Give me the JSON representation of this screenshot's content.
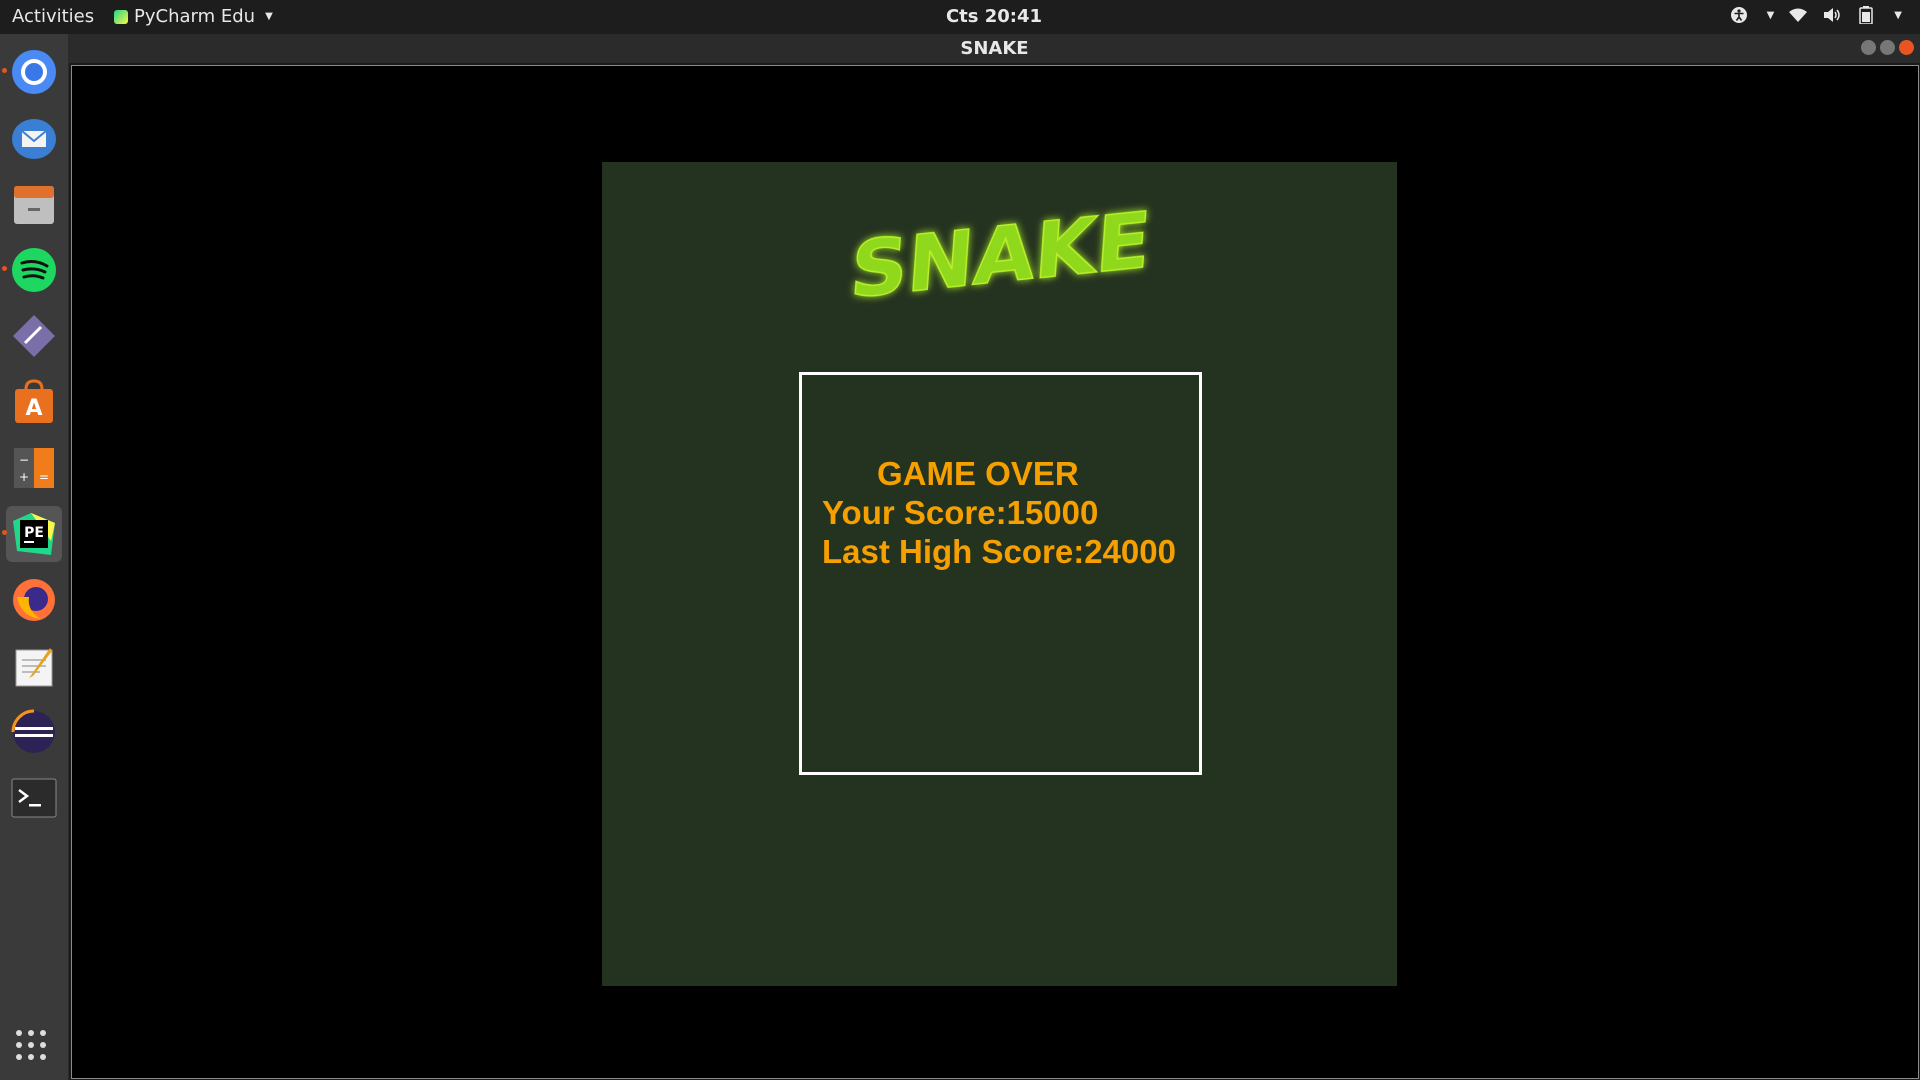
{
  "topbar": {
    "activities": "Activities",
    "app_name": "PyCharm Edu",
    "clock": "Cts 20:41"
  },
  "dock": {
    "items": [
      {
        "name": "chromium-icon"
      },
      {
        "name": "thunderbird-icon"
      },
      {
        "name": "files-icon"
      },
      {
        "name": "spotify-icon"
      },
      {
        "name": "remmina-icon"
      },
      {
        "name": "software-center-icon"
      },
      {
        "name": "calculator-icon"
      },
      {
        "name": "pycharm-edu-icon"
      },
      {
        "name": "firefox-icon"
      },
      {
        "name": "text-editor-icon"
      },
      {
        "name": "eclipse-icon"
      },
      {
        "name": "terminal-icon"
      }
    ]
  },
  "window": {
    "title": "SNAKE"
  },
  "game": {
    "logo_text": "SNAKE",
    "game_over": "GAME OVER",
    "your_score": "Your Score:15000",
    "high_score": "Last High Score:24000",
    "colors": {
      "panel_bg": "#243220",
      "text": "#f5a000",
      "logo": "#8fd81a"
    }
  }
}
